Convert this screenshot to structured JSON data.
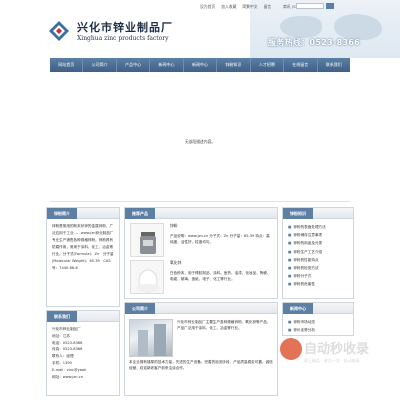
{
  "top_links": [
    "设为首页",
    "加入收藏",
    "简繁中文",
    "留言"
  ],
  "search": {
    "label": "商讯 (S)",
    "placeholder": ""
  },
  "logo": {
    "cn": "兴化市锌业制品厂",
    "en": "Xinghua zinc products factory"
  },
  "hotline": "服务热线：0523-8366",
  "nav": [
    "网站首页",
    "公司简介",
    "产品中心",
    "新闻中心",
    "新闻中心",
    "锌粉知识",
    "人才招聘",
    "在线留言",
    "联系我们"
  ],
  "banner_text": "无该段描述内容。",
  "panels": {
    "about": {
      "title": "锌粉简介",
      "text": "锌粉是常用的粉末状锌的金属锌粉，广泛应用于工业……www.jzn锌业制品厂专业生产销售各种规格锌粉。锌粉具有防腐作用，常用于涂料、化工、冶金等行业。分子式(Formula)：Zn　分子量(Molecular Weight)：65.39　CAS号：7440-66-6"
    },
    "products": {
      "title": "推荐产品",
      "items": [
        {
          "name": "锌粉",
          "desc": "产品说明：www.jzn.cn 分子式：Zn 分子量：65.39 特点：高纯度，活性好，粒度均匀。"
        },
        {
          "name": "氧化锌",
          "desc": "白色粉末，用于橡胶制品、涂料、医药、油漆、化妆品、陶瓷、电缆、玻璃、造纸、电子、化工等行业。"
        }
      ]
    },
    "news": {
      "title": "锌粉知识",
      "items": [
        "锌粉的表面处理方法",
        "锌粉储存注意事项",
        "锌粉的用途及分类",
        "锌粉生产工艺介绍",
        "锌粉的性能特点",
        "锌粉的检测方法",
        "锌粉分子式",
        "锌粉的危害性"
      ]
    },
    "contact": {
      "title": "联系我们",
      "lines": [
        "兴化市锌业制品厂",
        "地址：江苏",
        "电话：0523-8366",
        "传真：0523-8366",
        "联系人：经理",
        "手机：1390",
        "E-mail：zinc@yeah",
        "网址：www.jzn.cn"
      ]
    },
    "company": {
      "title": "公司简介",
      "text": "兴化市锌业制品厂主要生产各种规格锌粉、氧化锌等产品，产品广泛用于涂料、化工、冶金等行业。",
      "text2": "本企业拥有雄厚的技术力量，先进的生产设备，完善的检测手段，产品质量稳定可靠。诚信经营，欢迎新老客户前来洽谈合作。"
    },
    "industry": {
      "title": "新闻中心",
      "items": [
        "锌粉市场动态",
        "锌价走势分析",
        "行业新闻",
        "企业新闻"
      ]
    }
  },
  "watermark": {
    "text": "自动秒收录",
    "sub": "载上精品 · 来访一次 · 自动收录"
  },
  "colors": {
    "nav": "#4a6d94",
    "tab": "#5d7fa4",
    "hotline_glow": "#6a84a0"
  }
}
